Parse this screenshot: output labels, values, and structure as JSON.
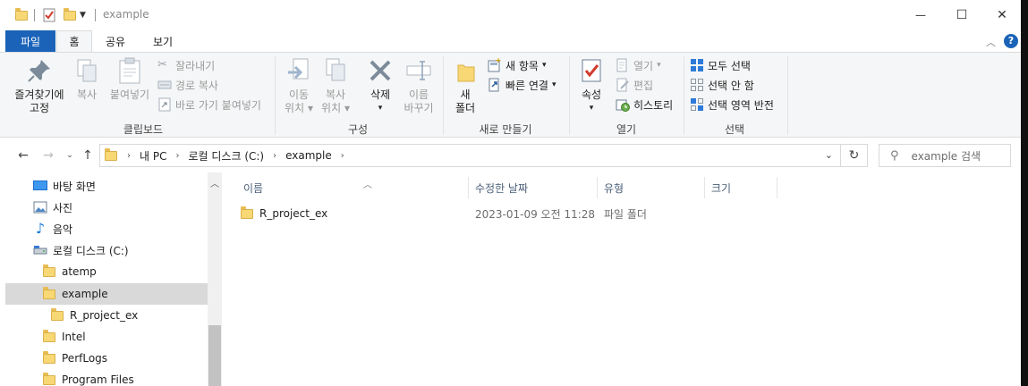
{
  "window": {
    "title": "example",
    "controls": {
      "minimize": "—",
      "maximize": "☐",
      "close": "✕"
    }
  },
  "ribbon_tabs": [
    {
      "label": "파일"
    },
    {
      "label": "홈"
    },
    {
      "label": "공유"
    },
    {
      "label": "보기"
    }
  ],
  "ribbon": {
    "clipboard": {
      "label": "클립보드",
      "pin_line1": "즐겨찾기에",
      "pin_line2": "고정",
      "copy": "복사",
      "paste": "붙여넣기",
      "cut": "잘라내기",
      "copy_path": "경로 복사",
      "paste_shortcut": "바로 가기 붙여넣기"
    },
    "organize": {
      "label": "구성",
      "move_line1": "이동",
      "move_line2": "위치",
      "copyto_line1": "복사",
      "copyto_line2": "위치",
      "delete": "삭제",
      "rename_line1": "이름",
      "rename_line2": "바꾸기"
    },
    "new": {
      "label": "새로 만들기",
      "folder_line1": "새",
      "folder_line2": "폴더",
      "new_item": "새 항목",
      "easy_access": "빠른 연결"
    },
    "open": {
      "label": "열기",
      "properties": "속성",
      "open": "열기",
      "edit": "편집",
      "history": "히스토리"
    },
    "select": {
      "label": "선택",
      "select_all": "모두 선택",
      "select_none": "선택 안 함",
      "invert": "선택 영역 반전"
    }
  },
  "address": {
    "segments": [
      "내 PC",
      "로컬 디스크 (C:)",
      "example"
    ],
    "search_placeholder": "example 검색"
  },
  "nav_tree": [
    {
      "label": "바탕 화면",
      "icon": "desktop-icon"
    },
    {
      "label": "사진",
      "icon": "pictures-icon"
    },
    {
      "label": "음악",
      "icon": "music-icon"
    },
    {
      "label": "로컬 디스크 (C:)",
      "icon": "drive-icon"
    },
    {
      "label": "atemp",
      "icon": "folder-icon"
    },
    {
      "label": "example",
      "icon": "folder-icon"
    },
    {
      "label": "R_project_ex",
      "icon": "folder-icon"
    },
    {
      "label": "Intel",
      "icon": "folder-icon"
    },
    {
      "label": "PerfLogs",
      "icon": "folder-icon"
    },
    {
      "label": "Program Files",
      "icon": "folder-icon"
    }
  ],
  "columns": [
    "이름",
    "수정한 날짜",
    "유형",
    "크기"
  ],
  "files": [
    {
      "name": "R_project_ex",
      "modified": "2023-01-09 오전 11:28",
      "type": "파일 폴더",
      "size": ""
    }
  ],
  "colors": {
    "accent": "#1a63b8",
    "folder": "#f8d775",
    "selection": "#d9d9d9"
  }
}
